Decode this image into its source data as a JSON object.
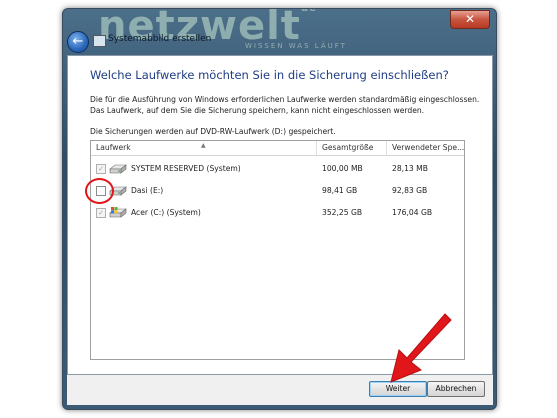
{
  "window": {
    "title": "Systemabbild erstellen",
    "watermark": "netzwelt",
    "watermark_sup": "de",
    "watermark_sub": "WISSEN WAS LÄUFT",
    "close_symbol": "✕",
    "back_symbol": "←"
  },
  "content": {
    "heading": "Welche Laufwerke möchten Sie in die Sicherung einschließen?",
    "description_line1": "Die für die Ausführung von Windows erforderlichen Laufwerke werden standardmäßig eingeschlossen.",
    "description_line2": "Das Laufwerk, auf dem Sie die Sicherung speichern, kann nicht eingeschlossen werden.",
    "save_info": "Die Sicherungen werden auf DVD-RW-Laufwerk (D:) gespeichert."
  },
  "table": {
    "headers": [
      "Laufwerk",
      "Gesamtgröße",
      "Verwendeter Spe..."
    ],
    "rows": [
      {
        "name": "SYSTEM RESERVED (System)",
        "size": "100,00 MB",
        "used": "28,13 MB",
        "checked": true,
        "disabled": true,
        "icon": "hard-drive-icon"
      },
      {
        "name": "Dasi (E:)",
        "size": "98,41 GB",
        "used": "92,83 GB",
        "checked": false,
        "disabled": false,
        "icon": "hard-drive-icon"
      },
      {
        "name": "Acer (C:) (System)",
        "size": "352,25 GB",
        "used": "176,04 GB",
        "checked": true,
        "disabled": true,
        "icon": "windows-drive-icon"
      }
    ]
  },
  "buttons": {
    "next": "Weiter",
    "cancel": "Abbrechen"
  },
  "colors": {
    "heading": "#1f3d85",
    "annotation_red": "#e0161b"
  }
}
